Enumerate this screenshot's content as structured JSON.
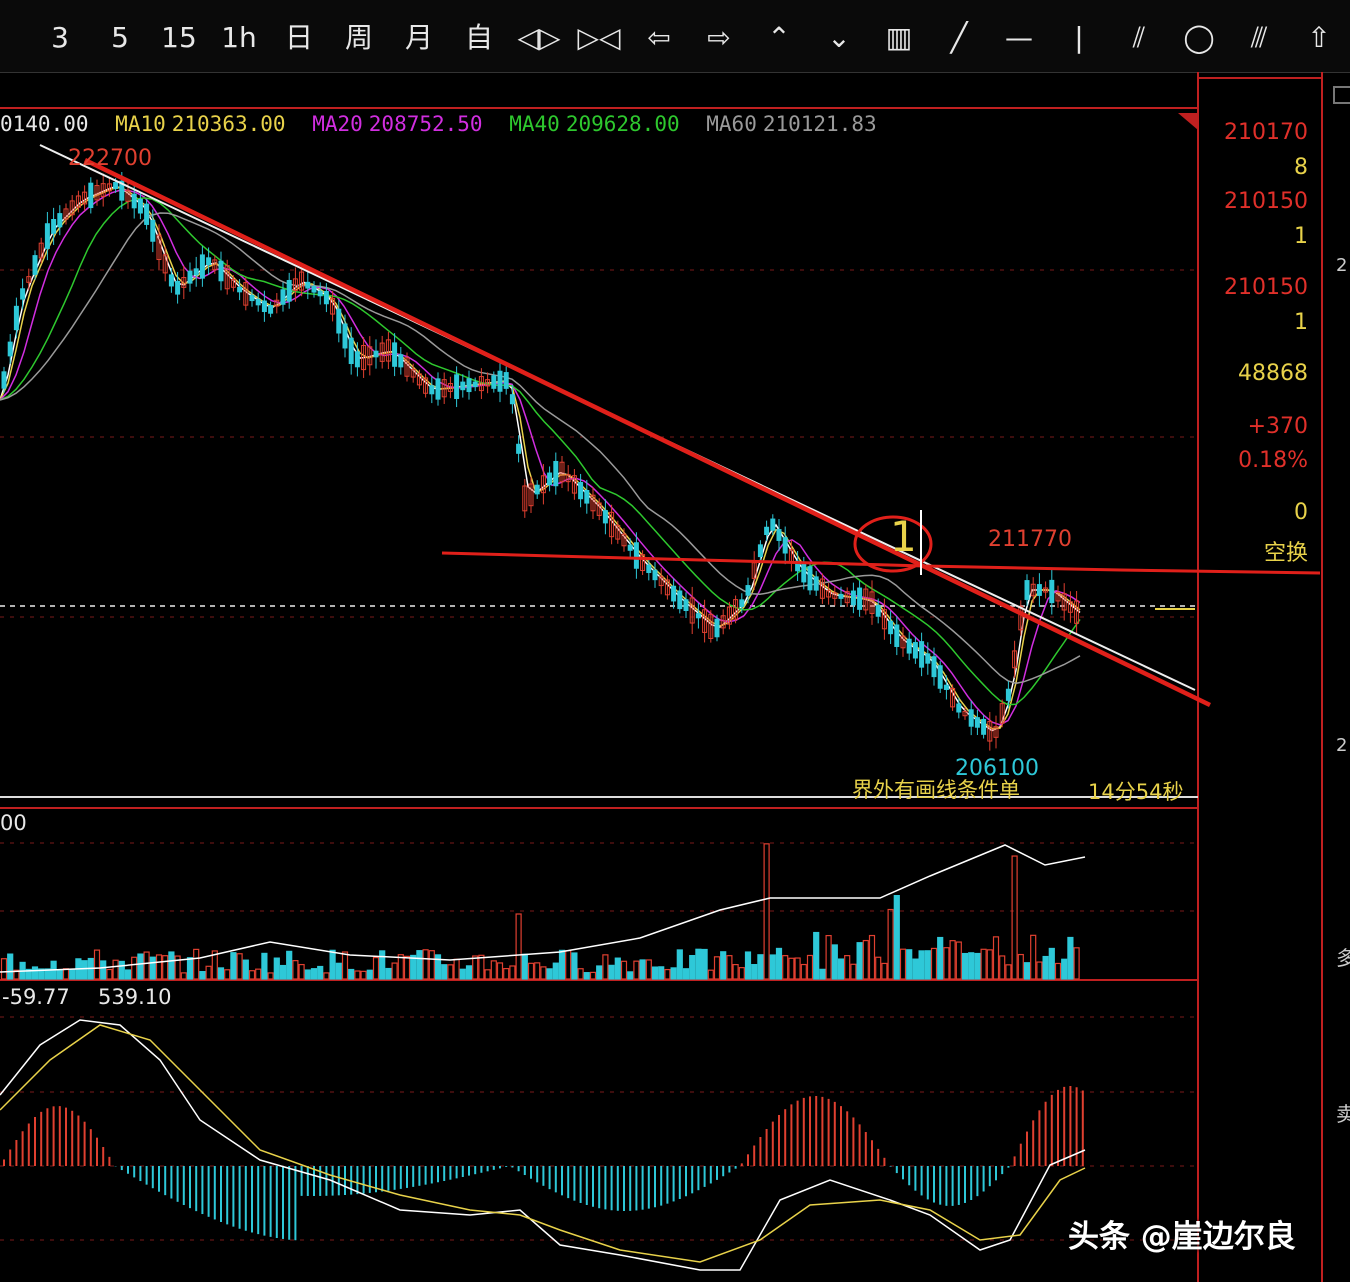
{
  "toolbar": {
    "buttons": [
      "3",
      "5",
      "15",
      "1h",
      "日",
      "周",
      "月",
      "自",
      "◁▷",
      "▷◁",
      "⇦",
      "⇨",
      "⌃",
      "⌄",
      "▥",
      "╱",
      "—",
      "|",
      "⫽",
      "◯",
      "⫻",
      "⇧"
    ]
  },
  "ma_line": {
    "ma5": "0140.00",
    "ma10_label": "MA10",
    "ma10": "210363.00",
    "ma20_label": "MA20",
    "ma20": "208752.50",
    "ma40_label": "MA40",
    "ma40": "209628.00",
    "ma60_label": "MA60",
    "ma60": "210121.83"
  },
  "colors": {
    "ma10": "#e8d24a",
    "ma20": "#d12ee0",
    "ma40": "#2ec82e",
    "ma60": "#9a9a9a",
    "up": "#e04030",
    "down": "#2ec8d8",
    "axis_red": "#e0302a"
  },
  "annotations": {
    "high_price": "222700",
    "low_price": "206100",
    "recent_high": "211770",
    "circle_mark": "1",
    "warning": "界外有画线条件单",
    "countdown": "14分54秒"
  },
  "right_panel": {
    "v1": "210170",
    "v2": "8",
    "v3": "210150",
    "v4": "1",
    "v5": "210150",
    "v6": "1",
    "volume": "48868",
    "change": "+370",
    "change_pct": "0.18%",
    "zero": "0",
    "status": "空换"
  },
  "volume_panel": {
    "label": "00"
  },
  "macd_panel": {
    "dif": "-59.77",
    "value": "539.10"
  },
  "far_right": {
    "c1": "2",
    "c2": "2",
    "c3": "多",
    "c4": "卖"
  },
  "watermark": "头条 @崖边尔良"
}
